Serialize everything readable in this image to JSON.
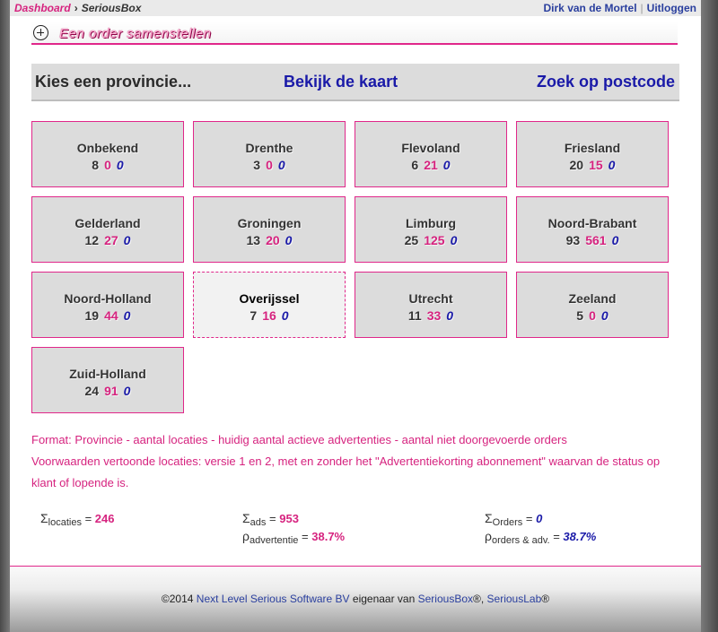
{
  "breadcrumb": {
    "home": "Dashboard",
    "separator": "›",
    "current": "SeriousBox"
  },
  "user": {
    "name": "Dirk van de Mortel",
    "separator": "|",
    "logout": "Uitloggen"
  },
  "order_bar": {
    "label": "Een order samenstellen"
  },
  "nav": {
    "province": "Kies een provincie...",
    "map": "Bekijk de kaart",
    "postcode": "Zoek op postcode"
  },
  "provinces": [
    {
      "name": "Onbekend",
      "locations": "8",
      "ads": "0",
      "orders": "0"
    },
    {
      "name": "Drenthe",
      "locations": "3",
      "ads": "0",
      "orders": "0"
    },
    {
      "name": "Flevoland",
      "locations": "6",
      "ads": "21",
      "orders": "0"
    },
    {
      "name": "Friesland",
      "locations": "20",
      "ads": "15",
      "orders": "0"
    },
    {
      "name": "Gelderland",
      "locations": "12",
      "ads": "27",
      "orders": "0"
    },
    {
      "name": "Groningen",
      "locations": "13",
      "ads": "20",
      "orders": "0"
    },
    {
      "name": "Limburg",
      "locations": "25",
      "ads": "125",
      "orders": "0"
    },
    {
      "name": "Noord-Brabant",
      "locations": "93",
      "ads": "561",
      "orders": "0"
    },
    {
      "name": "Noord-Holland",
      "locations": "19",
      "ads": "44",
      "orders": "0"
    },
    {
      "name": "Overijssel",
      "locations": "7",
      "ads": "16",
      "orders": "0"
    },
    {
      "name": "Utrecht",
      "locations": "11",
      "ads": "33",
      "orders": "0"
    },
    {
      "name": "Zeeland",
      "locations": "5",
      "ads": "0",
      "orders": "0"
    },
    {
      "name": "Zuid-Holland",
      "locations": "24",
      "ads": "91",
      "orders": "0"
    }
  ],
  "info": {
    "format": "Format: Provincie - aantal locaties - huidig aantal actieve advertenties - aantal niet doorgevoerde orders",
    "conditions": "Voorwaarden vertoonde locaties: versie 1 en 2, met en zonder het \"Advertentiekorting abonnement\" waarvan de status op klant of lopende is."
  },
  "stats": {
    "sigma": "Σ",
    "rho": "ρ",
    "equals": "=",
    "locations": {
      "label": "locaties",
      "value": "246"
    },
    "ads": {
      "label": "ads",
      "value": "953"
    },
    "orders": {
      "label": "Orders",
      "value": "0"
    },
    "rho_ads": {
      "label": "advertentie",
      "value": "38.7%"
    },
    "rho_orders": {
      "label": "orders & adv.",
      "value": "38.7%"
    }
  },
  "footer": {
    "prefix": "©2014",
    "company": "Next Level Serious Software BV",
    "middle": "eigenaar van",
    "brand1": "SeriousBox",
    "reg": "®",
    "comma": ",",
    "brand2": "SeriousLab"
  },
  "colors": {
    "accent": "#e0278a",
    "link": "#1a1aa8",
    "tile_bg": "#dcdcdc"
  }
}
